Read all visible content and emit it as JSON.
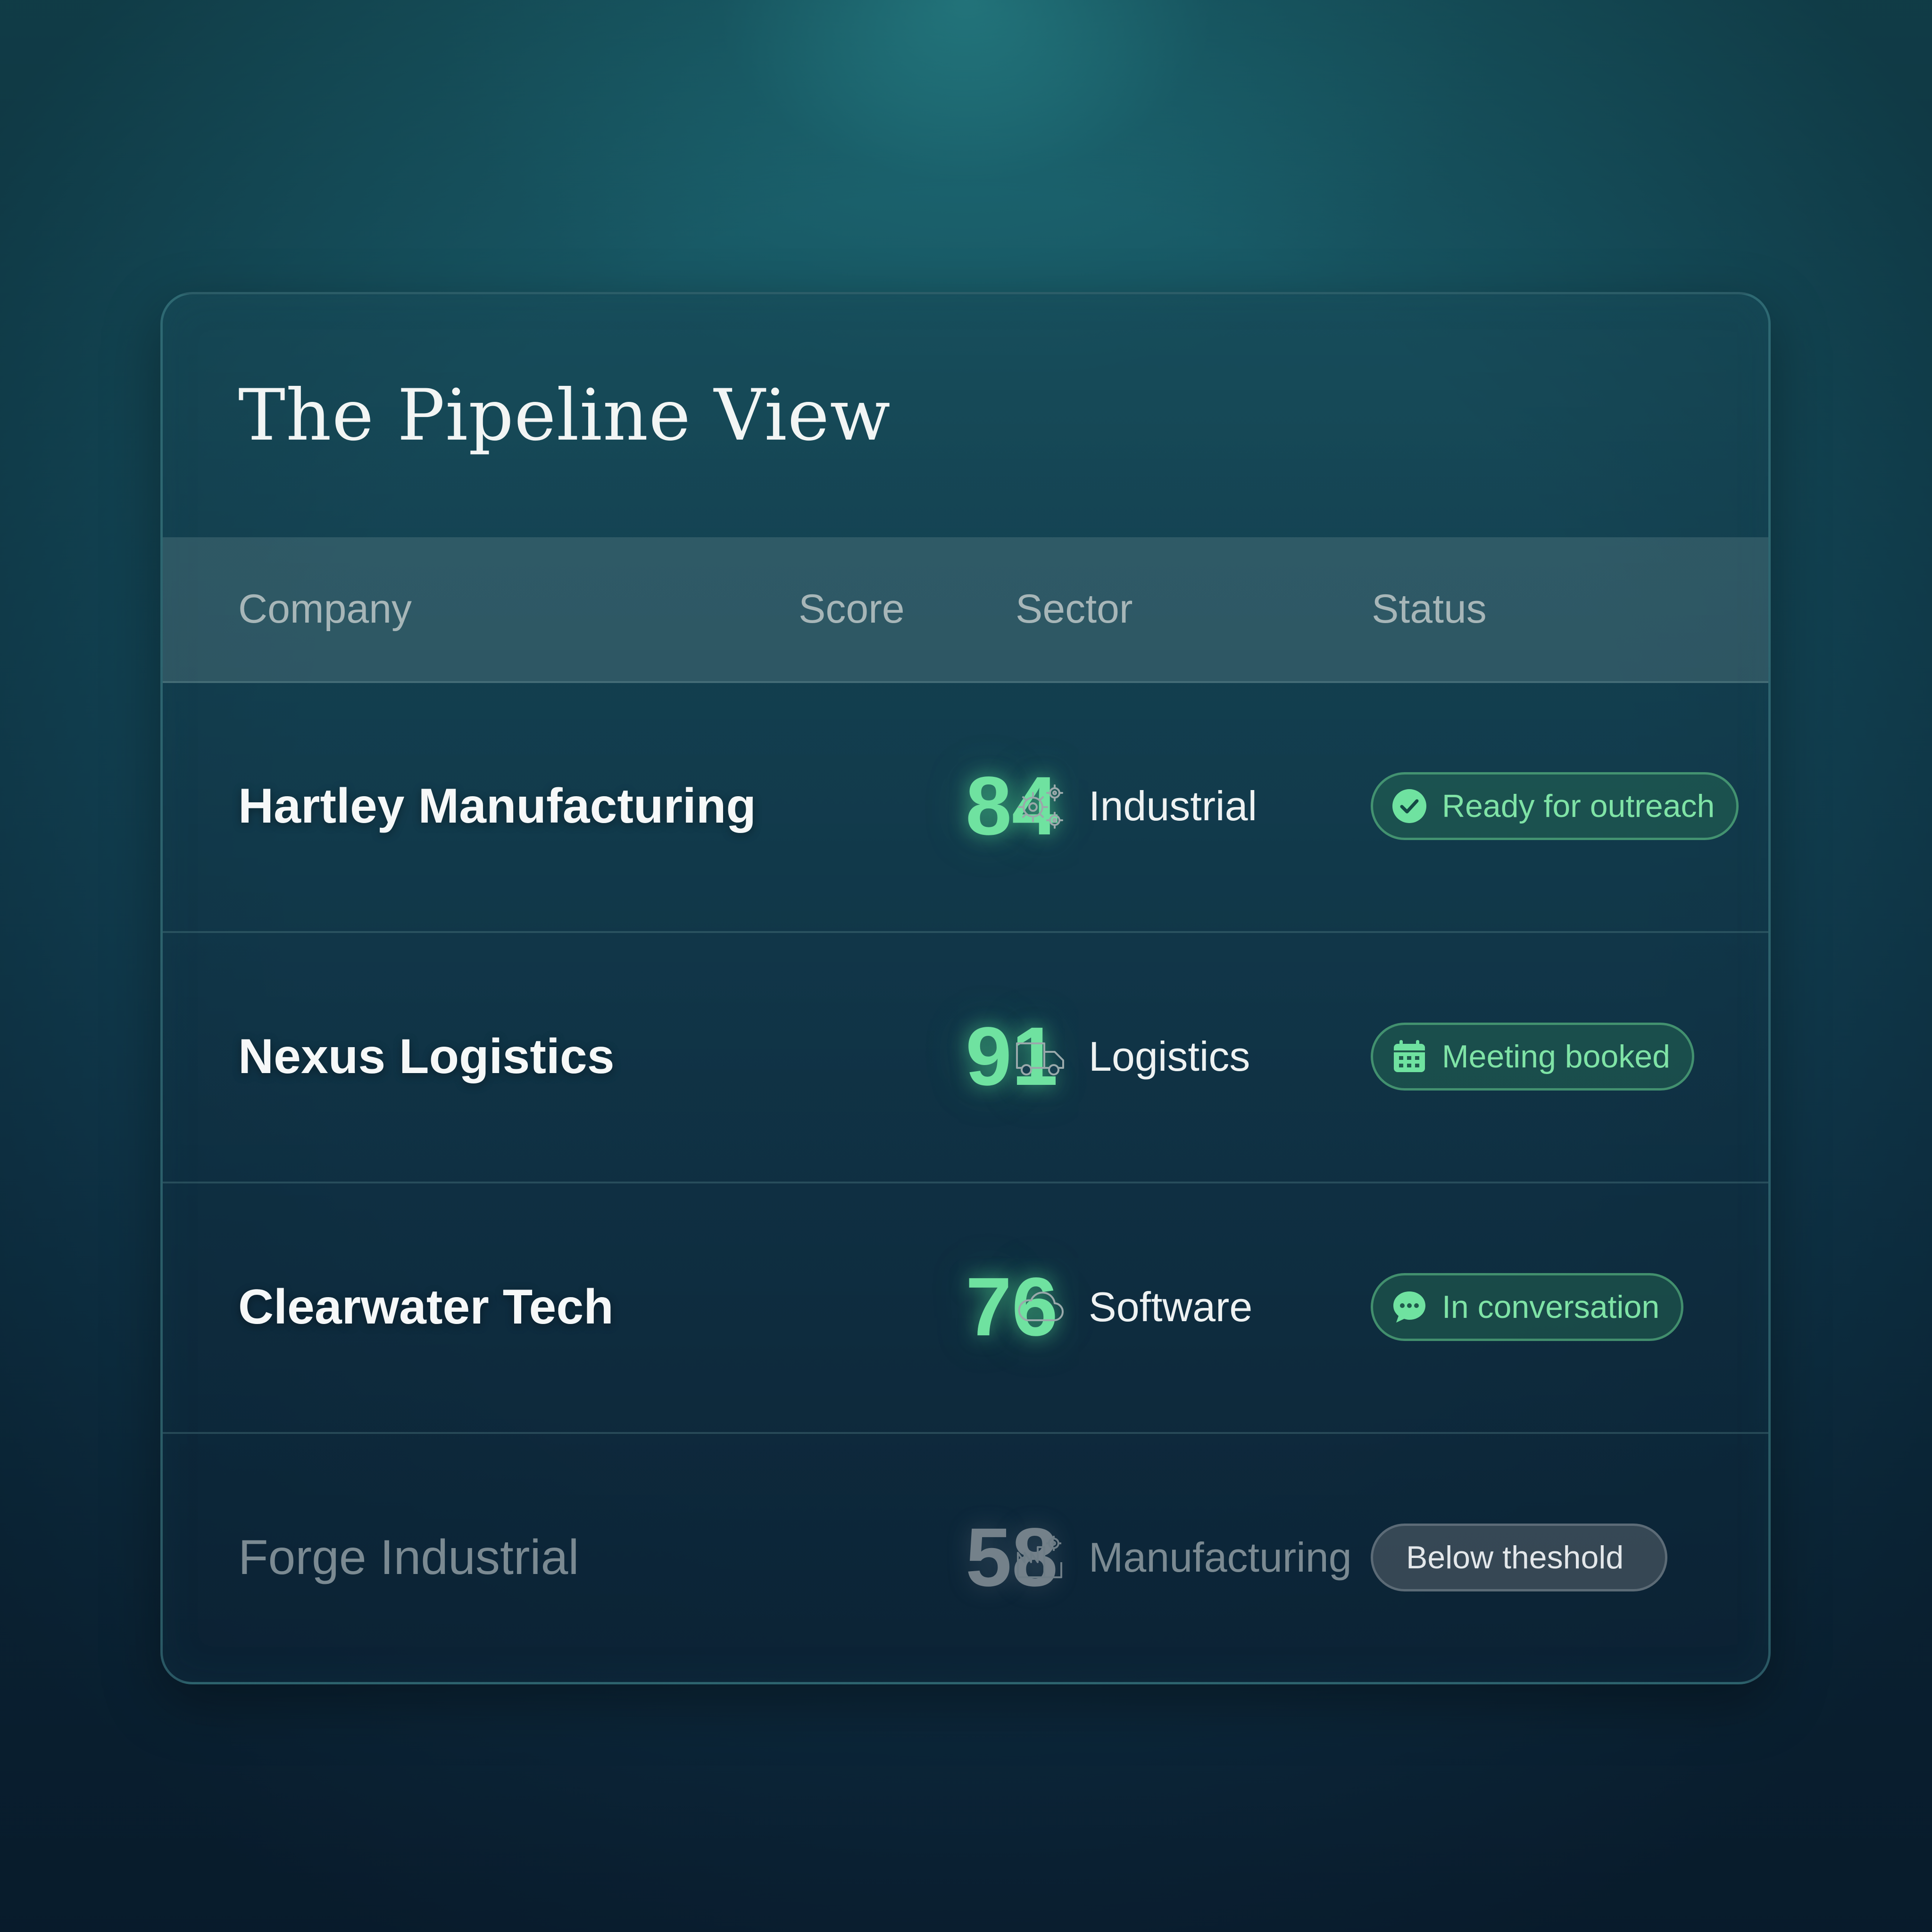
{
  "title": "The Pipeline View",
  "columns": {
    "company": "Company",
    "score": "Score",
    "sector": "Sector",
    "status": "Status"
  },
  "rows": [
    {
      "company": "Hartley Manufacturing",
      "score": "84",
      "sector": "Industrial",
      "sector_icon": "gears-icon",
      "status": "Ready for outreach",
      "status_icon": "check-circle-icon"
    },
    {
      "company": "Nexus Logistics",
      "score": "91",
      "sector": "Logistics",
      "sector_icon": "truck-icon",
      "status": "Meeting booked",
      "status_icon": "calendar-icon"
    },
    {
      "company": "Clearwater Tech",
      "score": "76",
      "sector": "Software",
      "sector_icon": "cloud-icon",
      "status": "In conversation",
      "status_icon": "chat-bubble-icon"
    },
    {
      "company": "Forge Industrial",
      "score": "58",
      "sector": "Manufacturing",
      "sector_icon": "factory-icon",
      "status": "Below theshold",
      "status_icon": ""
    }
  ],
  "colors": {
    "accent_green": "#6fe2a0",
    "dim_gray": "#7b8a92"
  }
}
